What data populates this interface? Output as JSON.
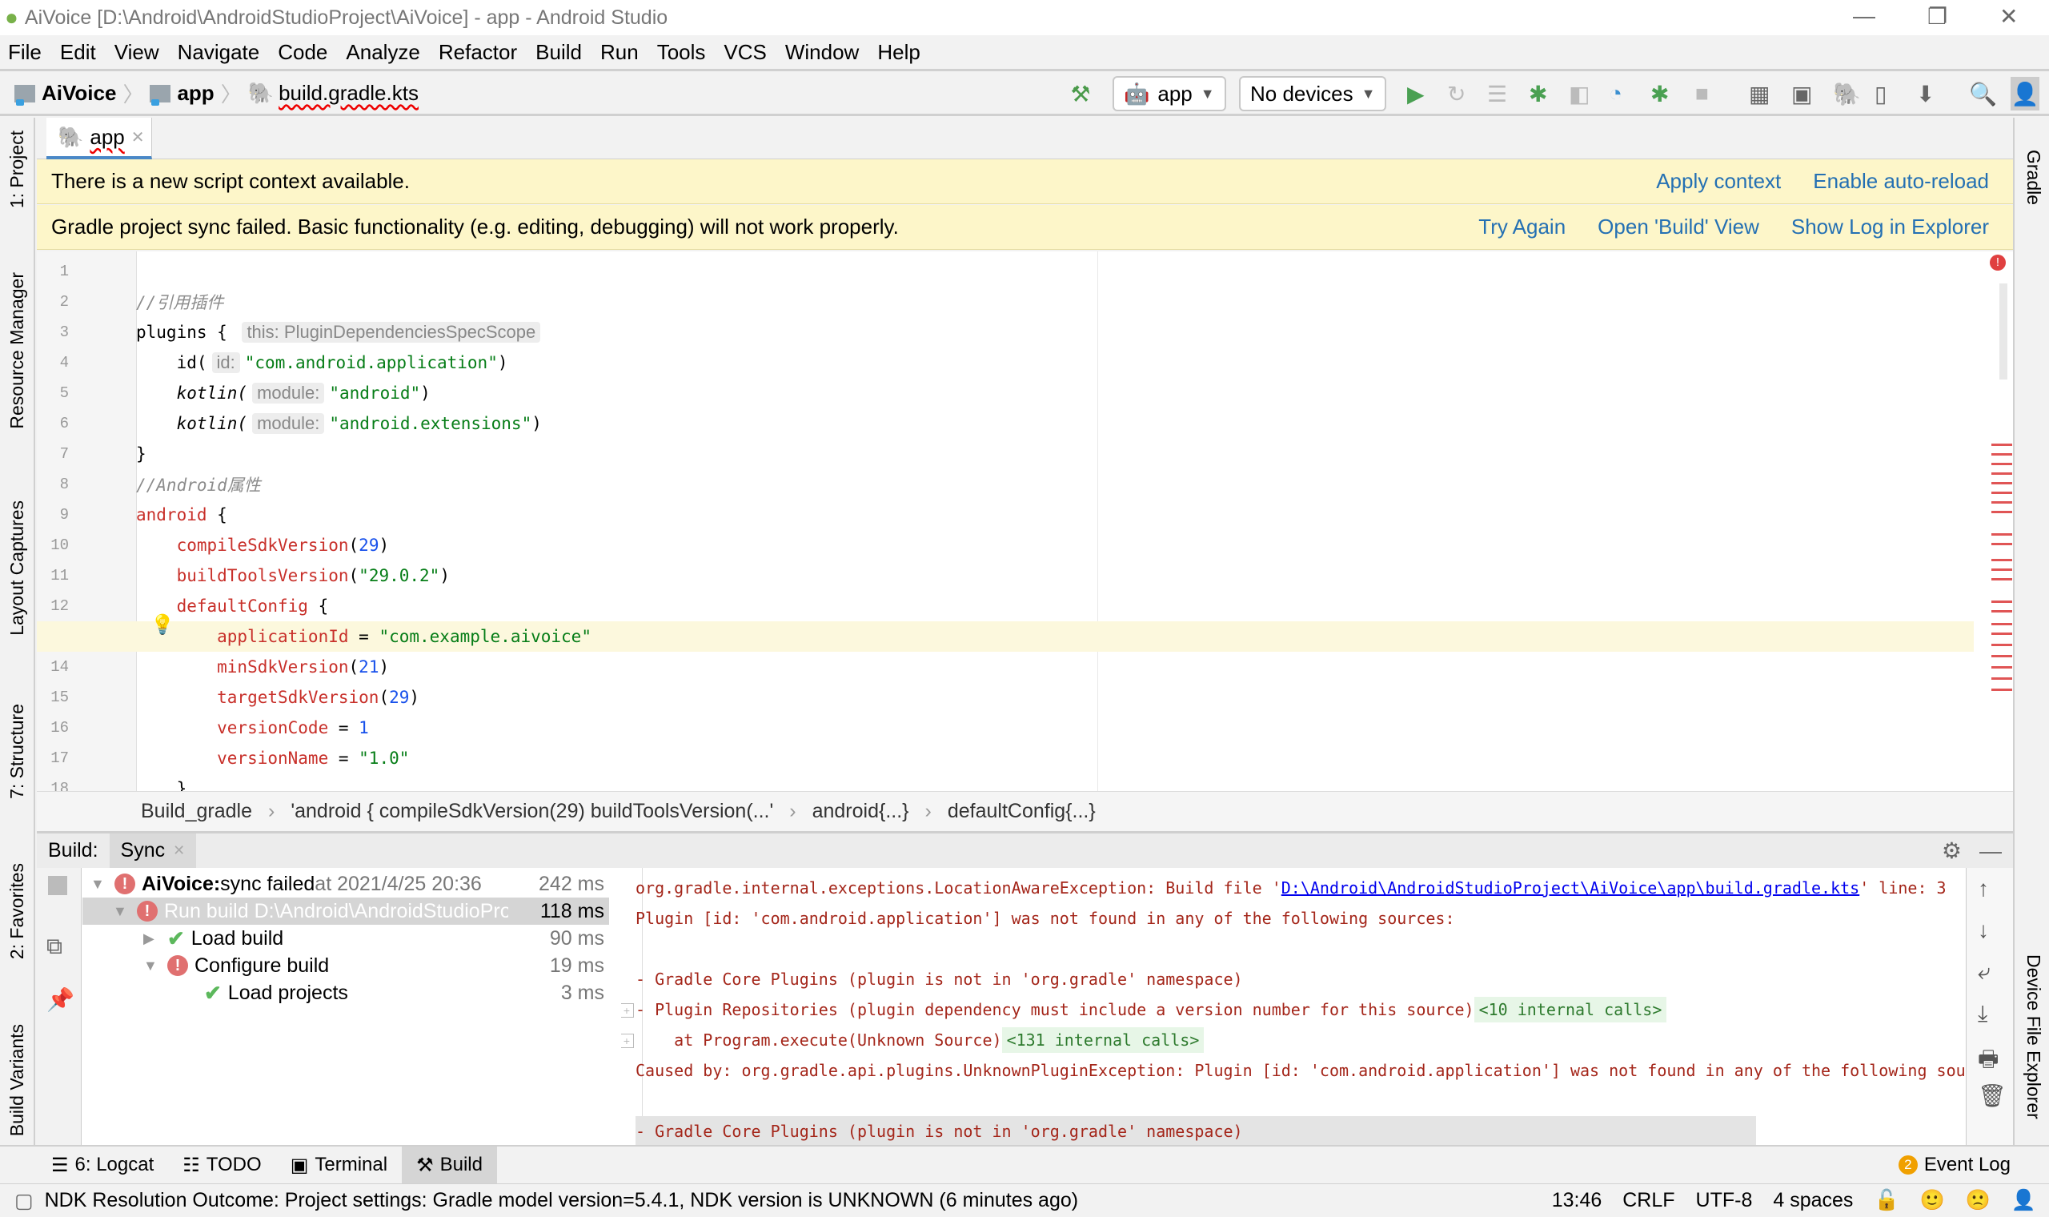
{
  "window": {
    "title": "AiVoice [D:\\Android\\AndroidStudioProject\\AiVoice] - app - Android Studio"
  },
  "menu": [
    "File",
    "Edit",
    "View",
    "Navigate",
    "Code",
    "Analyze",
    "Refactor",
    "Build",
    "Run",
    "Tools",
    "VCS",
    "Window",
    "Help"
  ],
  "nav": {
    "project": "AiVoice",
    "module": "app",
    "file": "build.gradle.kts"
  },
  "toolbar": {
    "run_config": "app",
    "device": "No devices"
  },
  "left_tools": [
    "1: Project",
    "Resource Manager",
    "Layout Captures",
    "7: Structure",
    "2: Favorites",
    "Build Variants"
  ],
  "right_tools": [
    "Gradle",
    "Device File Explorer"
  ],
  "editor_tab": "app",
  "banners": {
    "script_context": {
      "text": "There is a new script context available.",
      "links": [
        "Apply context",
        "Enable auto-reload"
      ]
    },
    "sync_failed": {
      "text": "Gradle project sync failed. Basic functionality (e.g. editing, debugging) will not work properly.",
      "links": [
        "Try Again",
        "Open 'Build' View",
        "Show Log in Explorer"
      ]
    }
  },
  "code": [
    [],
    [
      [
        "cmt",
        "//引用插件"
      ]
    ],
    [
      [
        "plain",
        "plugins { "
      ],
      [
        "hint",
        "this: PluginDependenciesSpecScope"
      ]
    ],
    [
      [
        "plain",
        "    id("
      ],
      [
        "hint",
        "id:"
      ],
      [
        "str",
        "\"com.android.application\""
      ],
      [
        "plain",
        ")"
      ]
    ],
    [
      [
        "ital",
        "    kotlin("
      ],
      [
        "hint",
        "module:"
      ],
      [
        "str",
        "\"android\""
      ],
      [
        "plain",
        ")"
      ]
    ],
    [
      [
        "ital",
        "    kotlin("
      ],
      [
        "hint",
        "module:"
      ],
      [
        "str",
        "\"android.extensions\""
      ],
      [
        "plain",
        ")"
      ]
    ],
    [
      [
        "plain",
        "}"
      ]
    ],
    [
      [
        "cmt",
        "//Android属性"
      ]
    ],
    [
      [
        "red",
        "android"
      ],
      [
        "plain",
        " {"
      ]
    ],
    [
      [
        "red",
        "    compileSdkVersion"
      ],
      [
        "plain",
        "("
      ],
      [
        "num",
        "29"
      ],
      [
        "plain",
        ")"
      ]
    ],
    [
      [
        "red",
        "    buildToolsVersion"
      ],
      [
        "plain",
        "("
      ],
      [
        "str",
        "\"29.0.2\""
      ],
      [
        "plain",
        ")"
      ]
    ],
    [
      [
        "red",
        "    defaultConfig"
      ],
      [
        "plain",
        " {"
      ]
    ],
    [
      [
        "red",
        "        applicationId"
      ],
      [
        "plain",
        " = "
      ],
      [
        "str",
        "\"com.example.aivoice\""
      ]
    ],
    [
      [
        "red",
        "        minSdkVersion"
      ],
      [
        "plain",
        "("
      ],
      [
        "num",
        "21"
      ],
      [
        "plain",
        ")"
      ]
    ],
    [
      [
        "red",
        "        targetSdkVersion"
      ],
      [
        "plain",
        "("
      ],
      [
        "num",
        "29"
      ],
      [
        "plain",
        ")"
      ]
    ],
    [
      [
        "red",
        "        versionCode"
      ],
      [
        "plain",
        " = "
      ],
      [
        "num",
        "1"
      ]
    ],
    [
      [
        "red",
        "        versionName"
      ],
      [
        "plain",
        " = "
      ],
      [
        "str",
        "\"1.0\""
      ]
    ],
    [
      [
        "plain",
        "    }"
      ]
    ]
  ],
  "editor_breadcrumbs": [
    "Build_gradle",
    "'android { compileSdkVersion(29) buildToolsVersion(...'",
    "android{...}",
    "defaultConfig{...}"
  ],
  "build": {
    "label": "Build:",
    "tab": "Sync",
    "tree": [
      {
        "bold": "AiVoice:",
        "text": " sync failed",
        "extra": " at 2021/4/25 20:36",
        "time": "242 ms",
        "status": "error"
      },
      {
        "text": "Run build D:\\Android\\AndroidStudioProject\\AiVoice",
        "time": "118 ms",
        "status": "error"
      },
      {
        "text": "Load build",
        "time": "90 ms",
        "status": "ok"
      },
      {
        "text": "Configure build",
        "time": "19 ms",
        "status": "error"
      },
      {
        "text": "Load projects",
        "time": "3 ms",
        "status": "ok"
      }
    ],
    "console": {
      "l1_pre": "org.gradle.internal.exceptions.LocationAwareException: Build file '",
      "l1_link": "D:\\Android\\AndroidStudioProject\\AiVoice\\app\\build.gradle.kts",
      "l1_post": "' line: 3",
      "l2": "Plugin [id: 'com.android.application'] was not found in any of the following sources:",
      "l4": "- Gradle Core Plugins (plugin is not in 'org.gradle' namespace)",
      "l5": "- Plugin Repositories (plugin dependency must include a version number for this source)",
      "l5_calls": "<10 internal calls>",
      "l6": "    at Program.execute(Unknown Source)",
      "l6_calls": "<131 internal calls>",
      "l7": "Caused by: org.gradle.api.plugins.UnknownPluginException: Plugin [id: 'com.android.application'] was not found in any of the following sou",
      "l9": "- Gradle Core Plugins (plugin is not in 'org.gradle' namespace)"
    }
  },
  "bottom_tabs": [
    "6: Logcat",
    "TODO",
    "Terminal",
    "Build"
  ],
  "event_log": {
    "label": "Event Log",
    "count": "2"
  },
  "status": {
    "message": "NDK Resolution Outcome: Project settings: Gradle model version=5.4.1, NDK version is UNKNOWN (6 minutes ago)",
    "position": "13:46",
    "line_sep": "CRLF",
    "encoding": "UTF-8",
    "indent": "4 spaces"
  },
  "colors": {
    "banner": "#fdf6c9",
    "link": "#2470b3",
    "error": "#e07070",
    "ok": "#5cb85c"
  }
}
